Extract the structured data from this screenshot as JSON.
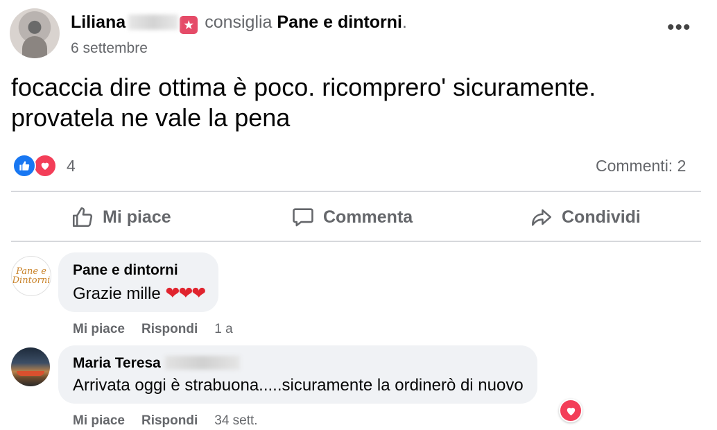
{
  "post": {
    "author_name": "Liliana",
    "recommends_text": "consiglia",
    "page_name": "Pane e dintorni",
    "period": ".",
    "date": "6 settembre",
    "body_line1": "focaccia dire ottima è poco. ricomprero' sicuramente.",
    "body_line2": "provatela ne vale la pena",
    "reaction_count": "4",
    "comment_count": "Commenti: 2"
  },
  "actions": {
    "like": "Mi piace",
    "comment": "Commenta",
    "share": "Condividi"
  },
  "comments": [
    {
      "author": "Pane e dintorni",
      "avatar_text": "Pane e Dintorni",
      "text": "Grazie mille",
      "hearts": "❤❤❤",
      "like_label": "Mi piace",
      "reply_label": "Rispondi",
      "time": "1 a"
    },
    {
      "author": "Maria Teresa",
      "text": "Arrivata oggi è strabuona.....sicuramente la ordinerò di nuovo",
      "like_label": "Mi piace",
      "reply_label": "Rispondi",
      "time": "34 sett."
    }
  ],
  "colors": {
    "like_blue": "#1877f2",
    "love_red": "#f33e58",
    "secondary_text": "#65676b",
    "bubble_bg": "#f0f2f5"
  }
}
